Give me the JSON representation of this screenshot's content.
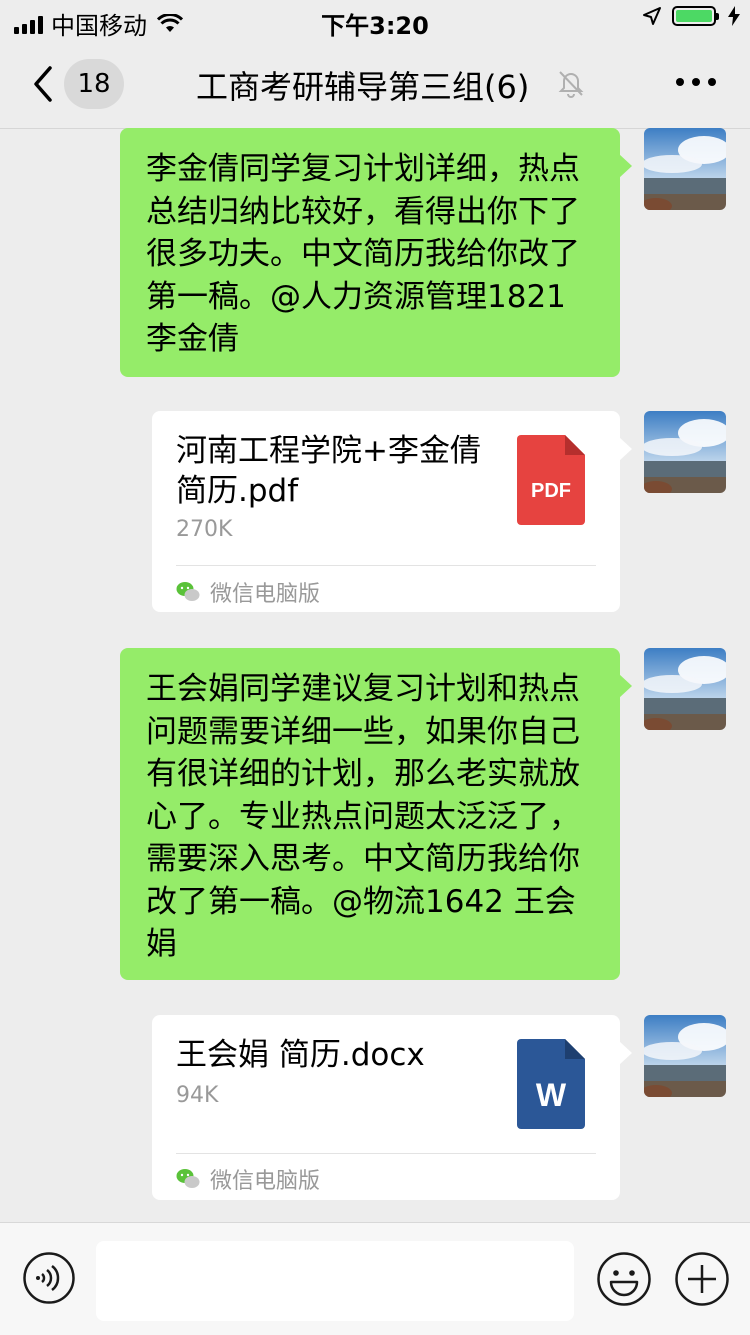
{
  "status_bar": {
    "carrier": "中国移动",
    "time": "下午3:20"
  },
  "nav": {
    "unread_count": "18",
    "title": "工商考研辅导第三组(6)"
  },
  "messages": [
    {
      "type": "text",
      "text": "李金倩同学复习计划详细，热点总结归纳比较好，看得出你下了很多功夫。中文简历我给你改了第一稿。@人力资源管理1821李金倩"
    },
    {
      "type": "file",
      "name": "河南工程学院+李金倩简历.pdf",
      "size": "270K",
      "file_icon": "pdf-icon",
      "icon_label": "PDF",
      "icon_color": "#e64340",
      "source": "微信电脑版"
    },
    {
      "type": "text",
      "text": "王会娟同学建议复习计划和热点问题需要详细一些，如果你自己有很详细的计划，那么老实就放心了。专业热点问题太泛泛了，需要深入思考。中文简历我给你改了第一稿。@物流1642 王会娟"
    },
    {
      "type": "file",
      "name": "王会娟 简历.docx",
      "size": "94K",
      "file_icon": "word-icon",
      "icon_label": "W",
      "icon_color": "#2b5797",
      "source": "微信电脑版"
    }
  ],
  "colors": {
    "bubble_green": "#95ec69",
    "background": "#ededed"
  }
}
